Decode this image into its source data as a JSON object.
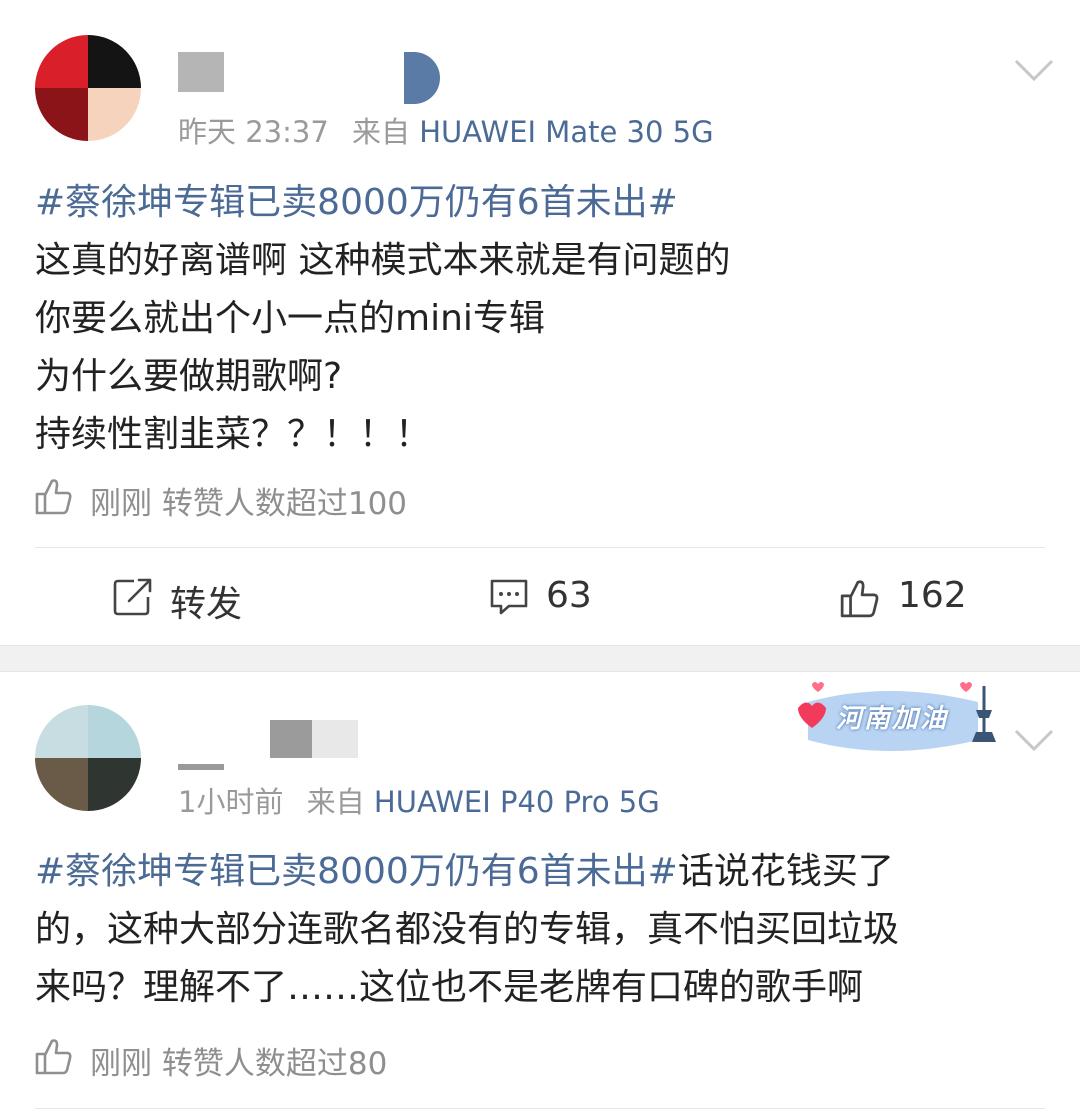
{
  "colors": {
    "link": "#4b6b96",
    "meta_gray": "#9a9a9a",
    "separator": "#f1f1f1"
  },
  "posts": [
    {
      "time": "昨天 23:37",
      "source_prefix": "来自",
      "source": "HUAWEI Mate 30 5G",
      "topic": "#蔡徐坤专辑已卖8000万仍有6首未出#",
      "lines": [
        "这真的好离谱啊 这种模式本来就是有问题的",
        "你要么就出个小一点的mini专辑",
        "为什么要做期歌啊?",
        "持续性割韭菜？？！！！"
      ],
      "liked_text": "刚刚 转赞人数超过100",
      "actions": {
        "repost_label": "转发",
        "comment_count": "63",
        "like_count": "162"
      },
      "icons": [
        "chevron-down-icon",
        "thumbs-up-icon",
        "repost-icon",
        "comment-icon",
        "like-icon"
      ]
    },
    {
      "time": "1小时前",
      "source_prefix": "来自",
      "source": "HUAWEI P40 Pro 5G",
      "topic": "#蔡徐坤专辑已卖8000万仍有6首未出#",
      "text": "话说花钱买了的，这种大部分连歌名都没有的专辑，真不怕买回垃圾来吗？理解不了……这位也不是老牌有口碑的歌手啊",
      "text_line1": "话说花钱买了",
      "text_line2": "的，这种大部分连歌名都没有的专辑，真不怕买回垃圾",
      "text_line3": "来吗？理解不了……这位也不是老牌有口碑的歌手啊",
      "badge_text": "河南加油",
      "liked_text": "刚刚 转赞人数超过80"
    }
  ]
}
